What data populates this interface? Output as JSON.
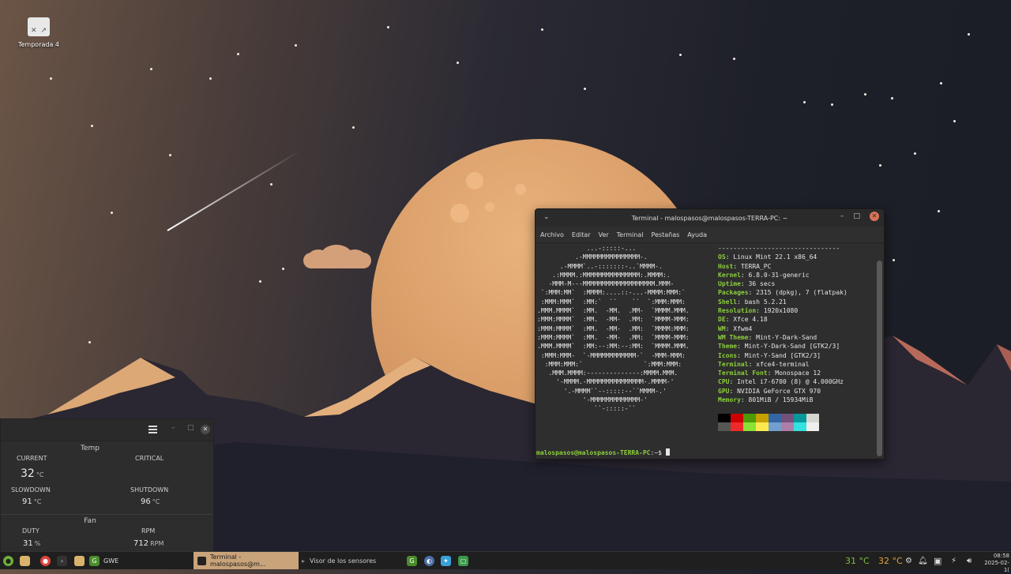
{
  "desktop": {
    "icon_label": "Temporada 4"
  },
  "terminal": {
    "title": "Terminal - malospasos@malospasos-TERRA-PC: ~",
    "menu": [
      "Archivo",
      "Editar",
      "Ver",
      "Terminal",
      "Pestañas",
      "Ayuda"
    ],
    "separator": "--------------------------------",
    "info": [
      {
        "key": "OS",
        "value": "Linux Mint 22.1 x86_64"
      },
      {
        "key": "Host",
        "value": "TERRA_PC"
      },
      {
        "key": "Kernel",
        "value": "6.8.0-31-generic"
      },
      {
        "key": "Uptime",
        "value": "36 secs"
      },
      {
        "key": "Packages",
        "value": "2315 (dpkg), 7 (flatpak)"
      },
      {
        "key": "Shell",
        "value": "bash 5.2.21"
      },
      {
        "key": "Resolution",
        "value": "1920x1080"
      },
      {
        "key": "DE",
        "value": "Xfce 4.18"
      },
      {
        "key": "WM",
        "value": "Xfwm4"
      },
      {
        "key": "WM Theme",
        "value": "Mint-Y-Dark-Sand"
      },
      {
        "key": "Theme",
        "value": "Mint-Y-Dark-Sand [GTK2/3]"
      },
      {
        "key": "Icons",
        "value": "Mint-Y-Sand [GTK2/3]"
      },
      {
        "key": "Terminal",
        "value": "xfce4-terminal"
      },
      {
        "key": "Terminal Font",
        "value": "Monospace 12"
      },
      {
        "key": "CPU",
        "value": "Intel i7-6700 (8) @ 4.000GHz"
      },
      {
        "key": "GPU",
        "value": "NVIDIA GeForce GTX 970"
      },
      {
        "key": "Memory",
        "value": "801MiB / 15934MiB"
      }
    ],
    "palette_top": [
      "#000000",
      "#cc0000",
      "#4e9a06",
      "#c4a000",
      "#3465a4",
      "#75507b",
      "#06989a",
      "#d3d7cf"
    ],
    "palette_bottom": [
      "#555753",
      "#ef2929",
      "#8ae234",
      "#fce94f",
      "#729fcf",
      "#ad7fa8",
      "#34e2e2",
      "#eeeeec"
    ],
    "prompt_user": "malospasos@malospasos-TERRA-PC",
    "prompt_suffix": ":~$ "
  },
  "sensors": {
    "temp_title": "Temp",
    "current_label": "CURRENT",
    "current_value": "32",
    "critical_label": "CRITICAL",
    "slowdown_label": "SLOWDOWN",
    "slowdown_value": "91",
    "shutdown_label": "SHUTDOWN",
    "shutdown_value": "96",
    "temp_unit": "°C",
    "fan_title": "Fan",
    "duty_label": "DUTY",
    "duty_value": "31",
    "duty_unit": "%",
    "rpm_label": "RPM",
    "rpm_value": "712",
    "rpm_unit": "RPM"
  },
  "taskbar": {
    "gwe_label": "GWE",
    "active_task": "Terminal - malospasos@m...",
    "sensors_task": "Visor de los sensores",
    "cpu_temp": "31 °C",
    "gpu_temp": "32 °C",
    "time": "08:58",
    "date": "2025-02-1("
  },
  "colors": {
    "accent": "#c9a37a",
    "prompt_green": "#8ccf3c",
    "close_orange": "#d97458"
  }
}
